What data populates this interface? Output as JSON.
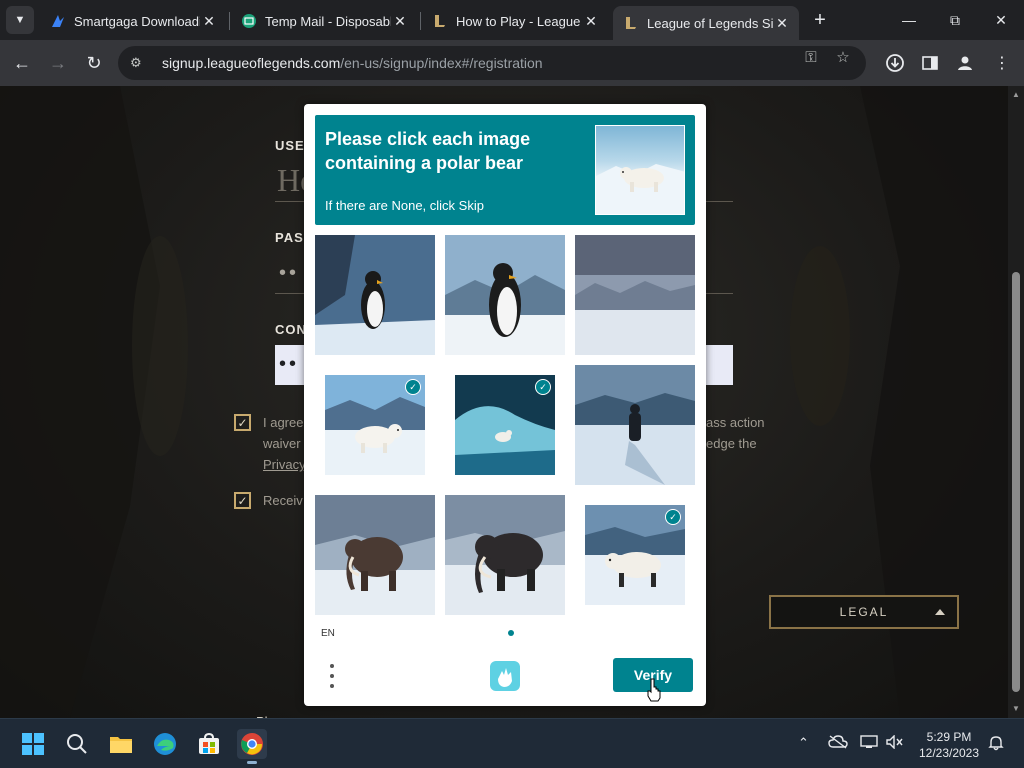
{
  "browser": {
    "tabs": [
      {
        "title": "Smartgaga Downloadi",
        "icon": "smartgaga-icon",
        "active": false
      },
      {
        "title": "Temp Mail - Disposabl",
        "icon": "tempmail-icon",
        "active": false
      },
      {
        "title": "How to Play - League",
        "icon": "league-icon",
        "active": false
      },
      {
        "title": "League of Legends Sig",
        "icon": "league-icon",
        "active": true
      }
    ],
    "url_host": "signup.leagueoflegends.com",
    "url_path": "/en-us/signup/index#/registration"
  },
  "form": {
    "username_label": "USE",
    "username_value": "He",
    "password_label": "PAS",
    "password_dots": "••",
    "confirm_label": "CON",
    "confirm_dots": "••",
    "agree_line1_left": "I agree",
    "agree_line1_right": "ass action",
    "agree_line2_left": "waiver",
    "agree_line2_right": "edge the",
    "agree_line3_link": "Privacy",
    "receive_label": "Receiv",
    "legal_label": "LEGAL",
    "play_label": "Pl"
  },
  "captcha": {
    "prompt": "Please click each image containing a polar bear",
    "subtext": "If there are None, click Skip",
    "tiles": [
      {
        "subject": "penguin",
        "selected": false
      },
      {
        "subject": "penguin",
        "selected": false
      },
      {
        "subject": "mountains",
        "selected": false
      },
      {
        "subject": "polar-bear",
        "selected": true
      },
      {
        "subject": "polar-bear-iceberg",
        "selected": true
      },
      {
        "subject": "person-walking",
        "selected": false
      },
      {
        "subject": "mammoth",
        "selected": false
      },
      {
        "subject": "mammoth",
        "selected": false
      },
      {
        "subject": "polar-bear",
        "selected": true
      }
    ],
    "language": "EN",
    "verify_label": "Verify",
    "accent_color": "#00838f"
  },
  "taskbar": {
    "apps": [
      "windows-start-icon",
      "search-icon",
      "file-explorer-icon",
      "edge-icon",
      "store-icon",
      "chrome-icon"
    ],
    "time": "5:29 PM",
    "date": "12/23/2023"
  }
}
